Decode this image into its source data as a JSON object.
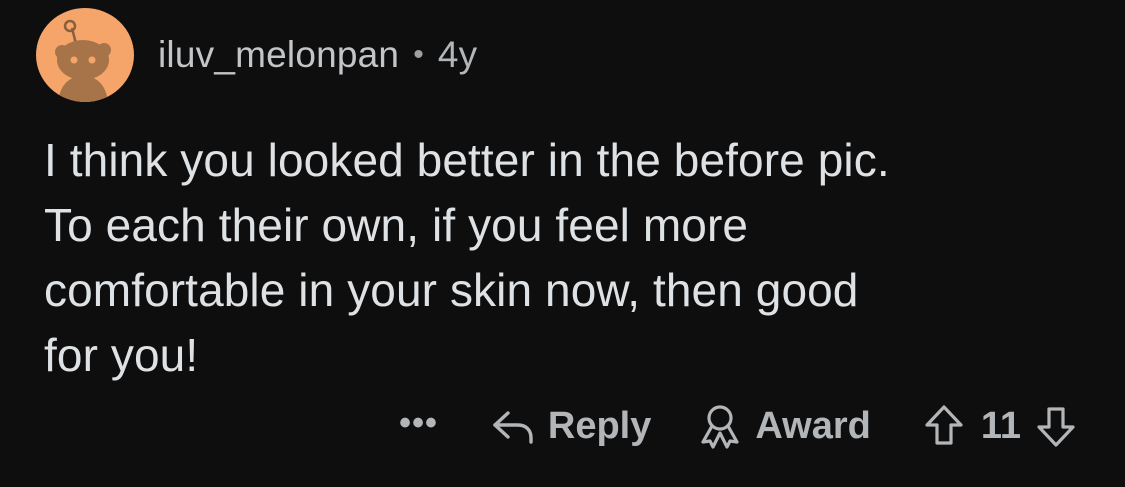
{
  "comment": {
    "author": "iluv_melonpan",
    "separator": "•",
    "age": "4y",
    "lines": [
      "I think you looked better in the before pic.",
      "To each their own, if you feel more",
      "comfortable in your skin now, then good",
      "for you!"
    ]
  },
  "actions": {
    "more_label": "•••",
    "reply_label": "Reply",
    "award_label": "Award",
    "vote_count": "11"
  },
  "icons": {
    "avatar": "snoo-avatar-icon",
    "reply": "reply-arrow-icon",
    "award": "award-ribbon-icon",
    "upvote": "upvote-arrow-icon",
    "downvote": "downvote-arrow-icon"
  },
  "colors": {
    "background": "#0e0e0f",
    "avatar_bg": "#f6a56a",
    "text": "#dfe2e4",
    "muted": "#b3b6b8"
  }
}
